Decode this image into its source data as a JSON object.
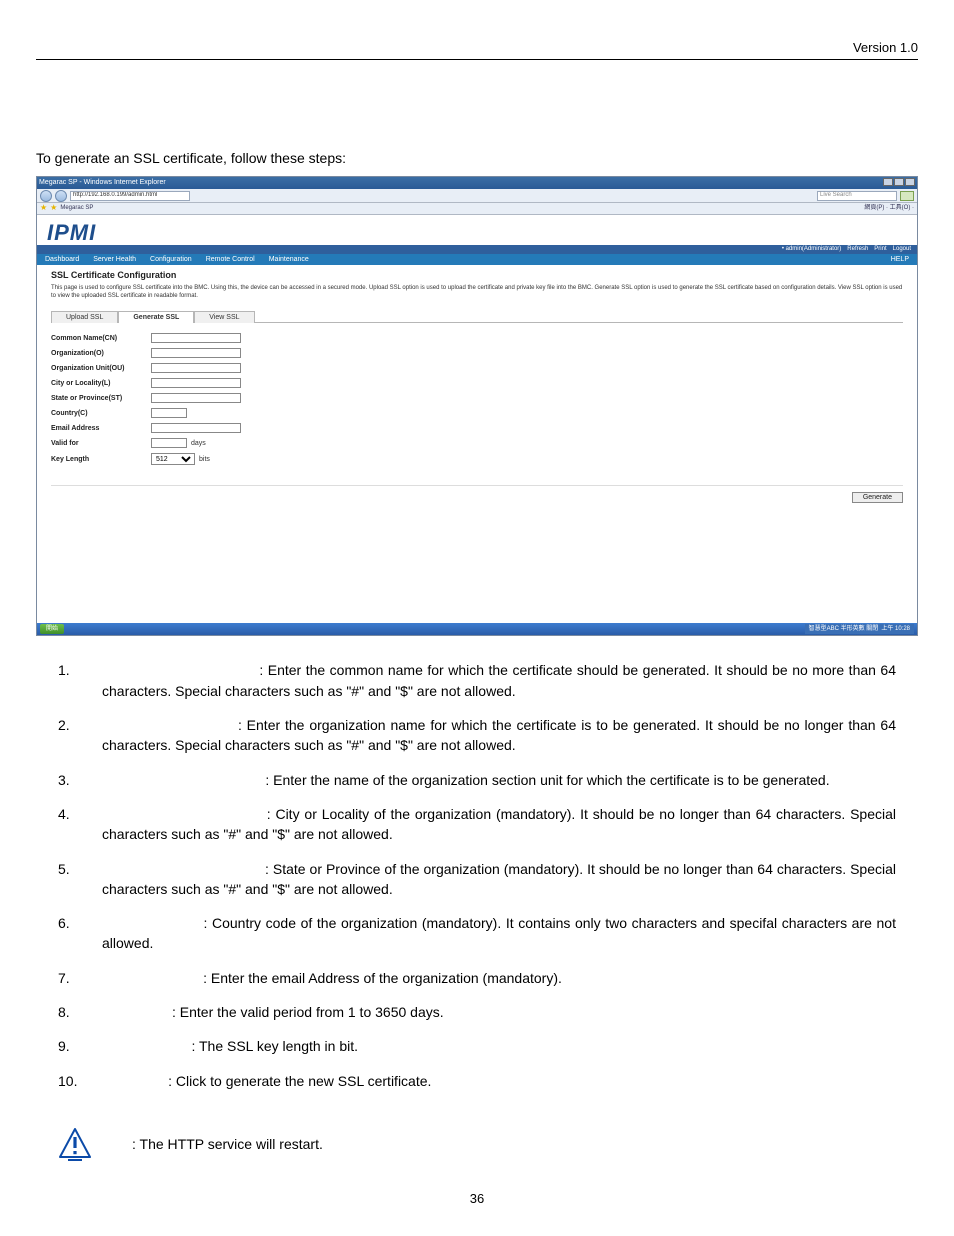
{
  "doc": {
    "version": "Version 1.0",
    "intro": "To generate an SSL certificate, follow these steps:",
    "page_number": "36"
  },
  "ie": {
    "title": "Megarac SP - Windows Internet Explorer",
    "address": "http://192.168.0.199/admin.html",
    "search_placeholder": "Live Search",
    "fav_tab": "Megarac SP",
    "tools_text": "網頁(P) · 工具(O) ·"
  },
  "ipmi": {
    "logo": "IPMI",
    "userbar": {
      "user": "admin(Administrator)",
      "refresh": "Refresh",
      "print": "Print",
      "logout": "Logout"
    },
    "menu": {
      "dashboard": "Dashboard",
      "server_health": "Server Health",
      "configuration": "Configuration",
      "remote_control": "Remote Control",
      "maintenance": "Maintenance",
      "help": "HELP"
    },
    "section_title": "SSL Certificate Configuration",
    "section_desc": "This page is used to configure SSL certificate into the BMC. Using this, the device can be accessed in a secured mode. Upload SSL option is used to upload the certificate and private key file into the BMC. Generate SSL option is used to generate the SSL certificate based on configuration details. View SSL option is used to view the uploaded SSL certificate in readable format.",
    "tabs": {
      "upload": "Upload SSL",
      "generate": "Generate SSL",
      "view": "View SSL"
    },
    "fields": {
      "cn": "Common Name(CN)",
      "o": "Organization(O)",
      "ou": "Organization Unit(OU)",
      "l": "City or Locality(L)",
      "st": "State or Province(ST)",
      "c": "Country(C)",
      "email": "Email Address",
      "valid": "Valid for",
      "valid_unit": "days",
      "keylen": "Key Length",
      "keylen_value": "512",
      "keylen_unit": "bits"
    },
    "generate_btn": "Generate"
  },
  "taskbar": {
    "start": "開始",
    "tray_text": "智慧型ABC 半形英數 關閉",
    "clock": "上午 10:28"
  },
  "steps": {
    "s1": "1.",
    "s1b": ": Enter the common name for which the certificate should be generated.  It  should  be no more than 64 characters. Special characters such as \"#\" and \"$\" are not allowed.",
    "s2": "2.",
    "s2b": ": Enter the organization name for which the certificate is to be generated. It should be no longer than 64 characters. Special characters such as \"#\" and \"$\" are not allowed.",
    "s3": "3.",
    "s3b": ": Enter the name of the organization section unit for which the certificate is to be generated.",
    "s4": "4.",
    "s4b": ": City or Locality of the organization (mandatory). It should be no longer than 64 characters. Special characters such as \"#\" and \"$\" are not allowed.",
    "s5": "5.",
    "s5b": ": State or Province of the organization (mandatory). It should be no longer than 64 characters. Special characters such as \"#\" and \"$\" are not allowed.",
    "s6": "6.",
    "s6b": ": Country code of the organization (mandatory). It contains only two characters and specifal characters are not allowed.",
    "s7": "7.",
    "s7b": ": Enter the email Address of the organization (mandatory).",
    "s8": "8.",
    "s8b": ": Enter the valid period from 1 to 3650 days.",
    "s9": "9.",
    "s9b": ": The SSL key length in bit.",
    "s10": "10.",
    "s10b": ": Click to generate the new SSL certificate."
  },
  "note": {
    "text": ": The HTTP service will restart."
  },
  "pads": {
    "p1": "                                   ",
    "p2": "                            ",
    "p3": "                                          ",
    "p4": "                                  ",
    "p5": "                                         ",
    "p6": "                      ",
    "p7": "                          ",
    "p8": "                  ",
    "p9": "                       ",
    "p10": "                 "
  }
}
